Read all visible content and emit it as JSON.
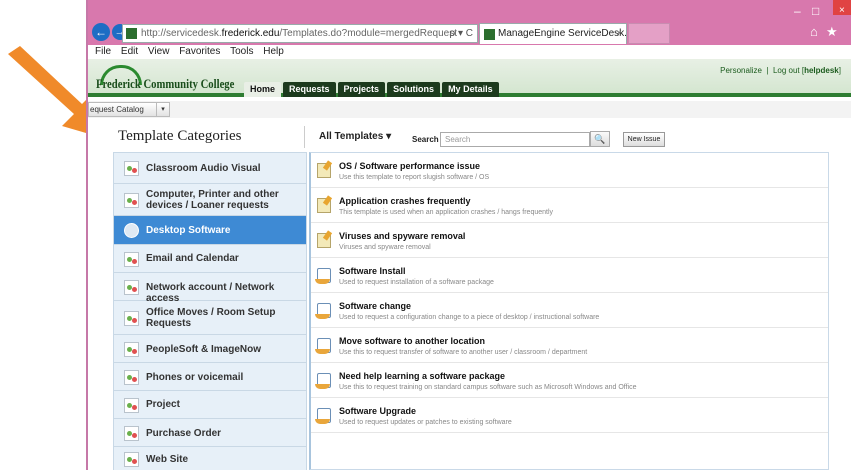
{
  "browser": {
    "url_prefix": "http://servicedesk.",
    "url_domain": "frederick.edu",
    "url_path": "/Templates.do?module=mergedRequest",
    "addr_controls": "ρ ▾ C",
    "tab_title": "ManageEngine ServiceDesk...",
    "tab_close": "×",
    "back": "←",
    "forward": "→",
    "win_min": "‒",
    "win_max": "□",
    "win_close": "×",
    "home_icon": "⌂",
    "star_icon": "★"
  },
  "menu": [
    "File",
    "Edit",
    "View",
    "Favorites",
    "Tools",
    "Help"
  ],
  "header": {
    "logo_text": "Frederick Community College",
    "personalize": "Personalize",
    "sep": "|",
    "logout_prefix": "Log out [",
    "user": "helpdesk",
    "logout_suffix": "]"
  },
  "nav_tabs": [
    "Home",
    "Requests",
    "Projects",
    "Solutions",
    "My Details"
  ],
  "catalog_button": "equest Catalog",
  "catalog_dd": "▾",
  "page_title": "Template Categories",
  "filter": {
    "label": "All Templates",
    "arrow": "▾"
  },
  "search": {
    "label": "Search",
    "placeholder": "Search",
    "icon": "🔍"
  },
  "new_issue": "New Issue",
  "categories": [
    "Classroom Audio Visual",
    "Computer, Printer and other devices / Loaner requests",
    "Desktop Software",
    "Email and Calendar",
    "Network account / Network access",
    "Office Moves / Room Setup Requests",
    "PeopleSoft & ImageNow",
    "Phones or voicemail",
    "Project",
    "Purchase Order",
    "Web Site"
  ],
  "selected_category": "Desktop Software",
  "templates": [
    {
      "title": "OS / Software performance issue",
      "desc": "Use this template to report slugish software / OS",
      "icon": "incident-icon"
    },
    {
      "title": "Application crashes frequently",
      "desc": "This template is used when an application crashes / hangs frequently",
      "icon": "incident-icon"
    },
    {
      "title": "Viruses and spyware removal",
      "desc": "Viruses and spyware removal",
      "icon": "incident-icon"
    },
    {
      "title": "Software Install",
      "desc": "Used to request installation of a software package",
      "icon": "service-request-icon"
    },
    {
      "title": "Software change",
      "desc": "Used to request a configuration change to a piece of desktop / instructional software",
      "icon": "service-request-icon"
    },
    {
      "title": "Move software to another location",
      "desc": "Use this to request transfer of software to another user / classroom / department",
      "icon": "service-request-icon"
    },
    {
      "title": "Need help learning a software package",
      "desc": "Use this to request training on standard campus software such as Microsoft Windows and Office",
      "icon": "service-request-icon"
    },
    {
      "title": "Software Upgrade",
      "desc": "Used to request updates or patches to existing software",
      "icon": "service-request-icon"
    }
  ],
  "colors": {
    "chrome": "#d878ad",
    "header_green": "#2e7d32",
    "selected_category": "#3e8ad4",
    "annotation_arrow": "#f08a2a"
  }
}
